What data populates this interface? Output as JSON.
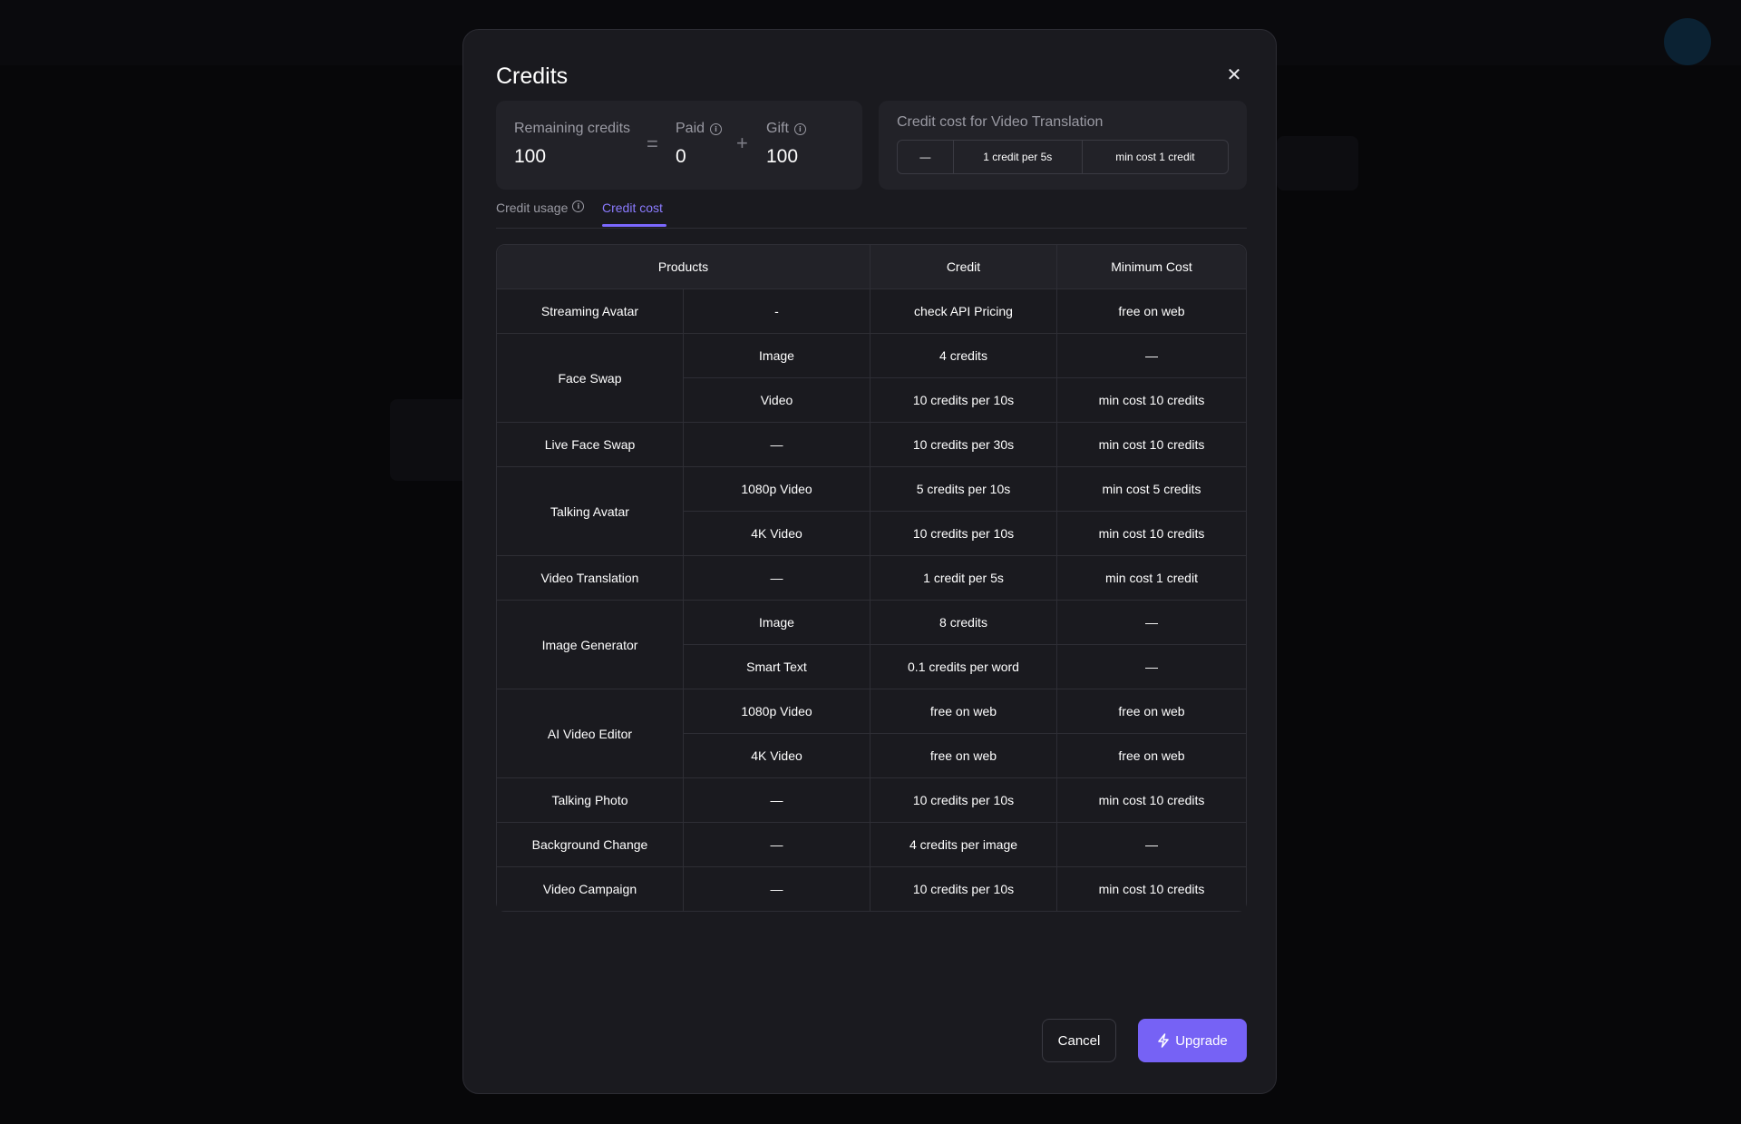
{
  "modal": {
    "title": "Credits",
    "close_icon": "close-icon",
    "close_glyph": "✕"
  },
  "summary": {
    "remaining_label": "Remaining credits",
    "remaining_value": "100",
    "equals": "=",
    "paid_label": "Paid",
    "paid_value": "0",
    "plus": "+",
    "gift_label": "Gift",
    "gift_value": "100",
    "info_glyph": "i"
  },
  "video_translation": {
    "title": "Credit cost for Video Translation",
    "segments": [
      "—",
      "1 credit per 5s",
      "min cost 1 credit"
    ]
  },
  "tabs": {
    "usage": "Credit usage",
    "cost": "Credit cost",
    "active": "cost"
  },
  "table": {
    "headers": [
      "Products",
      "Credit",
      "Minimum Cost"
    ],
    "groups": [
      {
        "product": "Streaming Avatar",
        "rows": [
          {
            "variant": "-",
            "credit": "check API Pricing",
            "min_cost": "free on web"
          }
        ]
      },
      {
        "product": "Face Swap",
        "rows": [
          {
            "variant": "Image",
            "credit": "4 credits",
            "min_cost": "—"
          },
          {
            "variant": "Video",
            "credit": "10 credits per 10s",
            "min_cost": "min cost 10 credits"
          }
        ]
      },
      {
        "product": "Live Face Swap",
        "rows": [
          {
            "variant": "—",
            "credit": "10 credits per 30s",
            "min_cost": "min cost 10 credits"
          }
        ]
      },
      {
        "product": "Talking Avatar",
        "rows": [
          {
            "variant": "1080p Video",
            "credit": "5 credits per 10s",
            "min_cost": "min cost 5 credits"
          },
          {
            "variant": "4K Video",
            "credit": "10 credits per 10s",
            "min_cost": "min cost 10 credits"
          }
        ]
      },
      {
        "product": "Video Translation",
        "rows": [
          {
            "variant": "—",
            "credit": "1 credit per 5s",
            "min_cost": "min cost 1 credit"
          }
        ]
      },
      {
        "product": "Image Generator",
        "rows": [
          {
            "variant": "Image",
            "credit": "8 credits",
            "min_cost": "—"
          },
          {
            "variant": "Smart Text",
            "credit": "0.1 credits per word",
            "min_cost": "—"
          }
        ]
      },
      {
        "product": "AI Video Editor",
        "rows": [
          {
            "variant": "1080p Video",
            "credit": "free on web",
            "min_cost": "free on web"
          },
          {
            "variant": "4K Video",
            "credit": "free on web",
            "min_cost": "free on web"
          }
        ]
      },
      {
        "product": "Talking Photo",
        "rows": [
          {
            "variant": "—",
            "credit": "10 credits per 10s",
            "min_cost": "min cost 10 credits"
          }
        ]
      },
      {
        "product": "Background Change",
        "rows": [
          {
            "variant": "—",
            "credit": "4 credits per image",
            "min_cost": "—"
          }
        ]
      },
      {
        "product": "Video Campaign",
        "rows": [
          {
            "variant": "—",
            "credit": "10 credits per 10s",
            "min_cost": "min cost 10 credits"
          }
        ]
      }
    ]
  },
  "footer": {
    "cancel_label": "Cancel",
    "upgrade_label": "Upgrade",
    "upgrade_icon": "lightning-icon"
  },
  "colors": {
    "accent": "#7662f5",
    "tab_active": "#8b7bff",
    "modal_bg": "#1a1a1f",
    "card_bg": "#222228"
  }
}
